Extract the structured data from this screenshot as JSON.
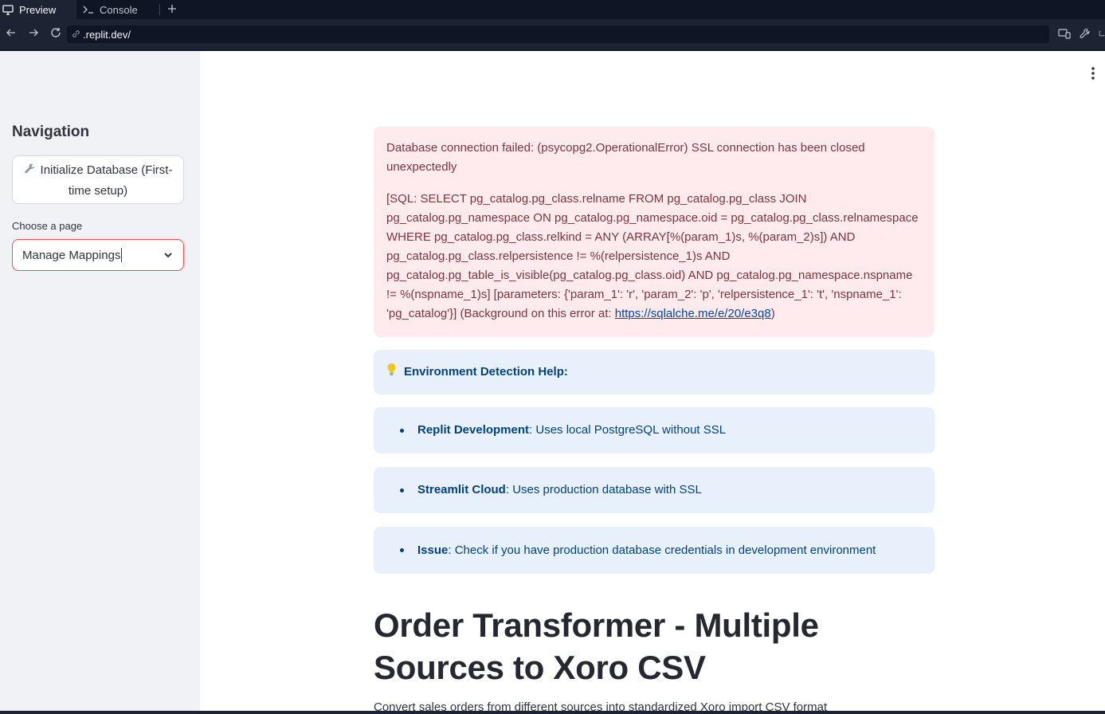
{
  "browser": {
    "tabs": [
      {
        "label": "Preview",
        "icon": "monitor-icon",
        "active": true
      },
      {
        "label": "Console",
        "icon": "terminal-icon",
        "active": false
      }
    ],
    "new_tab_icon": "plus-icon",
    "url": ".replit.dev/"
  },
  "sidebar": {
    "title": "Navigation",
    "init_button_icon": "wrench-icon",
    "init_button_label": "Initialize Database (First-time setup)",
    "choose_label": "Choose a page",
    "selected_page": "Manage Mappings"
  },
  "main": {
    "error": {
      "line1": "Database connection failed: (psycopg2.OperationalError) SSL connection has been closed unexpectedly",
      "line2_prefix": "[SQL: SELECT pg_catalog.pg_class.relname FROM pg_catalog.pg_class JOIN pg_catalog.pg_namespace ON pg_catalog.pg_namespace.oid = pg_catalog.pg_class.relnamespace WHERE pg_catalog.pg_class.relkind = ANY (ARRAY[%(param_1)s, %(param_2)s]) AND pg_catalog.pg_class.relpersistence != %(relpersistence_1)s AND pg_catalog.pg_table_is_visible(pg_catalog.pg_class.oid) AND pg_catalog.pg_namespace.nspname != %(nspname_1)s] [parameters: {'param_1': 'r', 'param_2': 'p', 'relpersistence_1': 't', 'nspname_1': 'pg_catalog'}] (Background on this error at: ",
      "link": "https://sqlalche.me/e/20/e3q8",
      "line2_suffix": ")"
    },
    "help": {
      "icon": "lightbulb-icon",
      "title": "Environment Detection Help:"
    },
    "items": [
      {
        "bold": "Replit Development",
        "text": ": Uses local PostgreSQL without SSL"
      },
      {
        "bold": "Streamlit Cloud",
        "text": ": Uses production database with SSL"
      },
      {
        "bold": "Issue",
        "text": ": Check if you have production database credentials in development environment"
      }
    ],
    "title": "Order Transformer - Multiple Sources to Xoro CSV",
    "subtitle": "Convert sales orders from different sources into standardized Xoro import CSV format"
  },
  "colors": {
    "error_bg": "#ffebee",
    "info_bg": "#e8f1fb",
    "accent": "#ff4b4b"
  }
}
